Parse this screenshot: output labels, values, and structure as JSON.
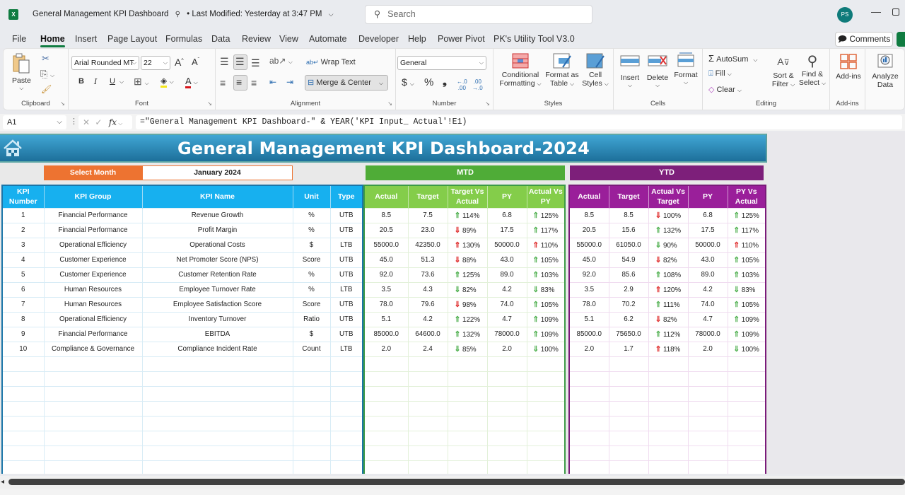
{
  "titlebar": {
    "app_icon": "excel-icon",
    "doc_title": "General Management KPI Dashboard",
    "autosave_icon": "person-sync-icon",
    "last_modified": "• Last Modified: Yesterday at 3:47 PM",
    "search_placeholder": "Search",
    "avatar_initials": "PS"
  },
  "menu": {
    "tabs": [
      "File",
      "Home",
      "Insert",
      "Page Layout",
      "Formulas",
      "Data",
      "Review",
      "View",
      "Automate",
      "Developer",
      "Help",
      "Power Pivot",
      "PK's Utility Tool V3.0"
    ],
    "active": "Home",
    "comments_label": "Comments"
  },
  "ribbon": {
    "clipboard": {
      "label": "Clipboard",
      "paste": "Paste"
    },
    "font": {
      "label": "Font",
      "font_name": "Arial Rounded MT",
      "font_size": "22",
      "bold": "B",
      "italic": "I",
      "underline": "U"
    },
    "alignment": {
      "label": "Alignment",
      "wrap_text": "Wrap Text",
      "merge_center": "Merge & Center"
    },
    "number": {
      "label": "Number",
      "format": "General",
      "currency": "$",
      "percent": "%",
      "comma": "❟"
    },
    "styles": {
      "label": "Styles",
      "conditional_1": "Conditional",
      "conditional_2": "Formatting",
      "format_table_1": "Format as",
      "format_table_2": "Table",
      "cell_styles_1": "Cell",
      "cell_styles_2": "Styles"
    },
    "cells": {
      "label": "Cells",
      "insert": "Insert",
      "delete": "Delete",
      "format": "Format"
    },
    "editing": {
      "label": "Editing",
      "autosum": "AutoSum",
      "fill": "Fill",
      "clear": "Clear",
      "sort_1": "Sort &",
      "sort_2": "Filter",
      "find_1": "Find &",
      "find_2": "Select"
    },
    "addins": {
      "label": "Add-ins",
      "addins": "Add-ins"
    },
    "analyze": {
      "label_1": "Analyze",
      "label_2": "Data"
    }
  },
  "formula_bar": {
    "name_box": "A1",
    "formula": "=\"General Management KPI Dashboard-\" & YEAR('KPI Input_ Actual'!E1)"
  },
  "dashboard": {
    "title": "General Management KPI Dashboard-2024",
    "select_month_label": "Select Month",
    "selected_month": "January 2024",
    "mtd_label": "MTD",
    "ytd_label": "YTD",
    "colors": {
      "banner": "#2a8cbd",
      "select_month": "#ed7331",
      "mtd": "#4fac37",
      "ytd": "#7d1f7a",
      "main_header": "#17b0ef",
      "mtd_header": "#84cd4a",
      "ytd_header": "#9a1f9a",
      "arrow_good": "#4fb04f",
      "arrow_bad": "#e03030"
    },
    "main_headers": [
      "KPI Number",
      "KPI Group",
      "KPI Name",
      "Unit",
      "Type"
    ],
    "mtd_headers": [
      "Actual",
      "Target",
      "Target Vs Actual",
      "PY",
      "Actual Vs PY"
    ],
    "ytd_headers": [
      "Actual",
      "Target",
      "Actual Vs Target",
      "PY",
      "PY Vs Actual"
    ],
    "rows": [
      {
        "num": "1",
        "group": "Financial Performance",
        "name": "Revenue Growth",
        "unit": "%",
        "type": "UTB",
        "mtd": {
          "actual": "8.5",
          "target": "7.5",
          "tva_arrow": "up",
          "tva_color": "green",
          "tva": "114%",
          "py": "6.8",
          "avpy_arrow": "up",
          "avpy_color": "green",
          "avpy": "125%"
        },
        "ytd": {
          "actual": "8.5",
          "target": "8.5",
          "avt_arrow": "down",
          "avt_color": "red",
          "avt": "100%",
          "py": "6.8",
          "pyva_arrow": "up",
          "pyva_color": "green",
          "pyva": "125%"
        }
      },
      {
        "num": "2",
        "group": "Financial Performance",
        "name": "Profit Margin",
        "unit": "%",
        "type": "UTB",
        "mtd": {
          "actual": "20.5",
          "target": "23.0",
          "tva_arrow": "down",
          "tva_color": "red",
          "tva": "89%",
          "py": "17.5",
          "avpy_arrow": "up",
          "avpy_color": "green",
          "avpy": "117%"
        },
        "ytd": {
          "actual": "20.5",
          "target": "15.6",
          "avt_arrow": "up",
          "avt_color": "green",
          "avt": "132%",
          "py": "17.5",
          "pyva_arrow": "up",
          "pyva_color": "green",
          "pyva": "117%"
        }
      },
      {
        "num": "3",
        "group": "Operational Efficiency",
        "name": "Operational Costs",
        "unit": "$",
        "type": "LTB",
        "mtd": {
          "actual": "55000.0",
          "target": "42350.0",
          "tva_arrow": "up",
          "tva_color": "red",
          "tva": "130%",
          "py": "50000.0",
          "avpy_arrow": "up",
          "avpy_color": "red",
          "avpy": "110%"
        },
        "ytd": {
          "actual": "55000.0",
          "target": "61050.0",
          "avt_arrow": "down",
          "avt_color": "green",
          "avt": "90%",
          "py": "50000.0",
          "pyva_arrow": "up",
          "pyva_color": "red",
          "pyva": "110%"
        }
      },
      {
        "num": "4",
        "group": "Customer Experience",
        "name": "Net Promoter Score (NPS)",
        "unit": "Score",
        "type": "UTB",
        "mtd": {
          "actual": "45.0",
          "target": "51.3",
          "tva_arrow": "down",
          "tva_color": "red",
          "tva": "88%",
          "py": "43.0",
          "avpy_arrow": "up",
          "avpy_color": "green",
          "avpy": "105%"
        },
        "ytd": {
          "actual": "45.0",
          "target": "54.9",
          "avt_arrow": "down",
          "avt_color": "red",
          "avt": "82%",
          "py": "43.0",
          "pyva_arrow": "up",
          "pyva_color": "green",
          "pyva": "105%"
        }
      },
      {
        "num": "5",
        "group": "Customer Experience",
        "name": "Customer Retention Rate",
        "unit": "%",
        "type": "UTB",
        "mtd": {
          "actual": "92.0",
          "target": "73.6",
          "tva_arrow": "up",
          "tva_color": "green",
          "tva": "125%",
          "py": "89.0",
          "avpy_arrow": "up",
          "avpy_color": "green",
          "avpy": "103%"
        },
        "ytd": {
          "actual": "92.0",
          "target": "85.6",
          "avt_arrow": "up",
          "avt_color": "green",
          "avt": "108%",
          "py": "89.0",
          "pyva_arrow": "up",
          "pyva_color": "green",
          "pyva": "103%"
        }
      },
      {
        "num": "6",
        "group": "Human Resources",
        "name": "Employee Turnover Rate",
        "unit": "%",
        "type": "LTB",
        "mtd": {
          "actual": "3.5",
          "target": "4.3",
          "tva_arrow": "down",
          "tva_color": "green",
          "tva": "82%",
          "py": "4.2",
          "avpy_arrow": "down",
          "avpy_color": "green",
          "avpy": "83%"
        },
        "ytd": {
          "actual": "3.5",
          "target": "2.9",
          "avt_arrow": "up",
          "avt_color": "red",
          "avt": "120%",
          "py": "4.2",
          "pyva_arrow": "down",
          "pyva_color": "green",
          "pyva": "83%"
        }
      },
      {
        "num": "7",
        "group": "Human Resources",
        "name": "Employee Satisfaction Score",
        "unit": "Score",
        "type": "UTB",
        "mtd": {
          "actual": "78.0",
          "target": "79.6",
          "tva_arrow": "down",
          "tva_color": "red",
          "tva": "98%",
          "py": "74.0",
          "avpy_arrow": "up",
          "avpy_color": "green",
          "avpy": "105%"
        },
        "ytd": {
          "actual": "78.0",
          "target": "70.2",
          "avt_arrow": "up",
          "avt_color": "green",
          "avt": "111%",
          "py": "74.0",
          "pyva_arrow": "up",
          "pyva_color": "green",
          "pyva": "105%"
        }
      },
      {
        "num": "8",
        "group": "Operational Efficiency",
        "name": "Inventory Turnover",
        "unit": "Ratio",
        "type": "UTB",
        "mtd": {
          "actual": "5.1",
          "target": "4.2",
          "tva_arrow": "up",
          "tva_color": "green",
          "tva": "122%",
          "py": "4.7",
          "avpy_arrow": "up",
          "avpy_color": "green",
          "avpy": "109%"
        },
        "ytd": {
          "actual": "5.1",
          "target": "6.2",
          "avt_arrow": "down",
          "avt_color": "red",
          "avt": "82%",
          "py": "4.7",
          "pyva_arrow": "up",
          "pyva_color": "green",
          "pyva": "109%"
        }
      },
      {
        "num": "9",
        "group": "Financial Performance",
        "name": "EBITDA",
        "unit": "$",
        "type": "UTB",
        "mtd": {
          "actual": "85000.0",
          "target": "64600.0",
          "tva_arrow": "up",
          "tva_color": "green",
          "tva": "132%",
          "py": "78000.0",
          "avpy_arrow": "up",
          "avpy_color": "green",
          "avpy": "109%"
        },
        "ytd": {
          "actual": "85000.0",
          "target": "75650.0",
          "avt_arrow": "up",
          "avt_color": "green",
          "avt": "112%",
          "py": "78000.0",
          "pyva_arrow": "up",
          "pyva_color": "green",
          "pyva": "109%"
        }
      },
      {
        "num": "10",
        "group": "Compliance & Governance",
        "name": "Compliance Incident Rate",
        "unit": "Count",
        "type": "LTB",
        "mtd": {
          "actual": "2.0",
          "target": "2.4",
          "tva_arrow": "down",
          "tva_color": "green",
          "tva": "85%",
          "py": "2.0",
          "avpy_arrow": "down",
          "avpy_color": "green",
          "avpy": "100%"
        },
        "ytd": {
          "actual": "2.0",
          "target": "1.7",
          "avt_arrow": "up",
          "avt_color": "red",
          "avt": "118%",
          "py": "2.0",
          "pyva_arrow": "down",
          "pyva_color": "green",
          "pyva": "100%"
        }
      }
    ],
    "empty_rows": 8
  }
}
